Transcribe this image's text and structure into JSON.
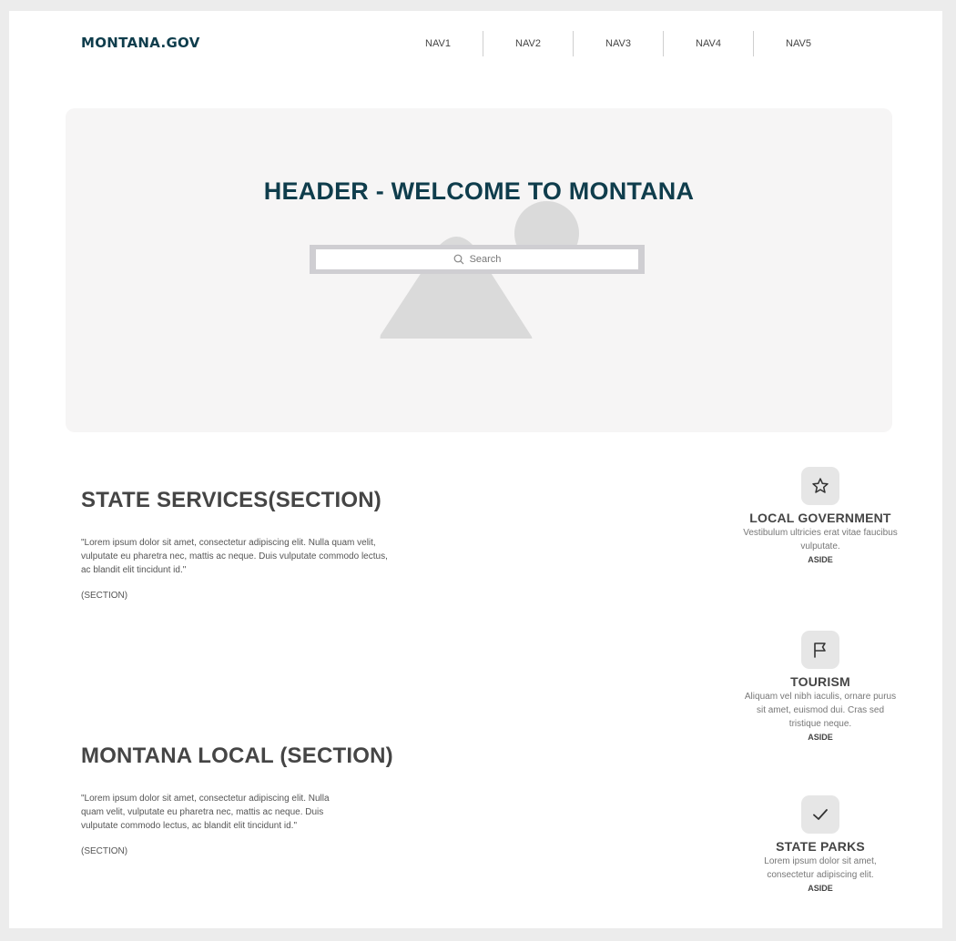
{
  "header": {
    "logo": "MONTANA.GOV",
    "nav": [
      "NAV1",
      "NAV2",
      "NAV3",
      "NAV4",
      "NAV5"
    ]
  },
  "hero": {
    "title": "HEADER - WELCOME TO MONTANA",
    "search_placeholder": "Search"
  },
  "sections": [
    {
      "title": "STATE SERVICES(SECTION)",
      "body": "\"Lorem ipsum dolor sit amet, consectetur adipiscing elit. Nulla quam velit, vulputate eu pharetra nec, mattis ac neque. Duis vulputate commodo lectus, ac blandit elit tincidunt id.\"",
      "tag": "(SECTION)"
    },
    {
      "title": "MONTANA LOCAL (SECTION)",
      "body": "\"Lorem ipsum dolor sit amet, consectetur adipiscing elit. Nulla quam velit, vulputate eu pharetra nec, mattis ac neque. Duis vulputate commodo lectus, ac blandit elit tincidunt id.\"",
      "tag": "(SECTION)"
    }
  ],
  "asides": [
    {
      "icon": "star-icon",
      "title": "LOCAL GOVERNMENT",
      "text": "Vestibulum ultricies erat vitae faucibus vulputate.",
      "tag": "ASIDE"
    },
    {
      "icon": "flag-icon",
      "title": "TOURISM",
      "text": "Aliquam vel nibh iaculis, ornare purus sit amet, euismod dui. Cras sed tristique neque.",
      "tag": "ASIDE"
    },
    {
      "icon": "check-icon",
      "title": "STATE PARKS",
      "text": "Lorem ipsum dolor sit amet, consectetur adipiscing elit.",
      "tag": "ASIDE"
    }
  ],
  "colors": {
    "brand": "#0f3d4c",
    "hero_bg": "#f6f5f5",
    "page_bg": "#ececec"
  }
}
